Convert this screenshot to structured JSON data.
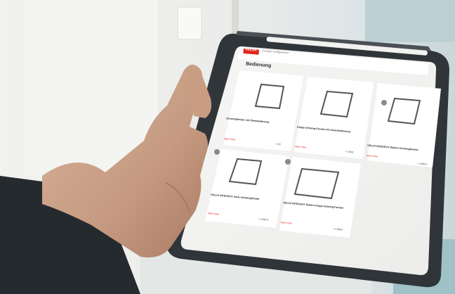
{
  "screen": {
    "brand": "VELUX",
    "breadcrumb": "Fenster konfigurieren",
    "title": "Bedienung",
    "cards": [
      {
        "name": "Schwingfenster mit Obenbedienung",
        "link": "Mehr Infos",
        "price": "+ 0 €"
      },
      {
        "name": "Klapp-Schwing-Fenster mit Untenbedienung",
        "link": "Mehr Infos",
        "price": "+ 159 €"
      },
      {
        "name": "VELUX INTEGRA® Elektro-Schwingfenster",
        "link": "Mehr Infos",
        "price": "+ 1.005 €"
      },
      {
        "name": "VELUX INTEGRA® Solar-Schwingfenster",
        "link": "Mehr Infos",
        "price": "+ 1.010 €"
      },
      {
        "name": "VELUX INTEGRA® Elektro-Klapp-Schwing-Fenster",
        "link": "Mehr Infos",
        "price": "+ 1.269 €"
      }
    ]
  },
  "colors": {
    "brand_red": "#e2241b",
    "card_bg": "#f7f7f6",
    "tablet_case": "#2f3336"
  }
}
